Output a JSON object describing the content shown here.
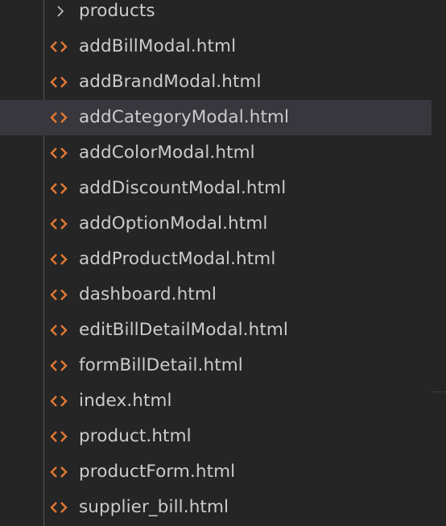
{
  "explorer": {
    "folder": {
      "label": "products",
      "icon": "chevron-right-icon",
      "expanded": false
    },
    "files": [
      {
        "label": "addBillModal.html",
        "icon": "html-file-icon",
        "selected": false
      },
      {
        "label": "addBrandModal.html",
        "icon": "html-file-icon",
        "selected": false
      },
      {
        "label": "addCategoryModal.html",
        "icon": "html-file-icon",
        "selected": true
      },
      {
        "label": "addColorModal.html",
        "icon": "html-file-icon",
        "selected": false
      },
      {
        "label": "addDiscountModal.html",
        "icon": "html-file-icon",
        "selected": false
      },
      {
        "label": "addOptionModal.html",
        "icon": "html-file-icon",
        "selected": false
      },
      {
        "label": "addProductModal.html",
        "icon": "html-file-icon",
        "selected": false
      },
      {
        "label": "dashboard.html",
        "icon": "html-file-icon",
        "selected": false
      },
      {
        "label": "editBillDetailModal.html",
        "icon": "html-file-icon",
        "selected": false
      },
      {
        "label": "formBillDetail.html",
        "icon": "html-file-icon",
        "selected": false
      },
      {
        "label": "index.html",
        "icon": "html-file-icon",
        "selected": false
      },
      {
        "label": "product.html",
        "icon": "html-file-icon",
        "selected": false
      },
      {
        "label": "productForm.html",
        "icon": "html-file-icon",
        "selected": false
      },
      {
        "label": "supplier_bill.html",
        "icon": "html-file-icon",
        "selected": false
      }
    ]
  },
  "colors": {
    "background": "#252526",
    "selected_row": "#37373d",
    "text": "#cccccc",
    "html_icon": "#e37933",
    "chevron": "#c5c5c5",
    "indent_guide": "#585858"
  }
}
